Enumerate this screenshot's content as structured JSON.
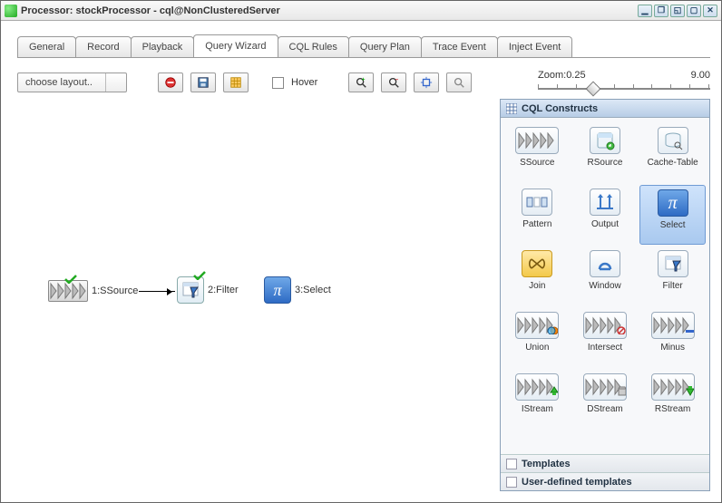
{
  "title": "Processor: stockProcessor - cql@NonClusteredServer",
  "tabs": [
    "General",
    "Record",
    "Playback",
    "Query Wizard",
    "CQL Rules",
    "Query Plan",
    "Trace Event",
    "Inject Event"
  ],
  "active_tab_index": 3,
  "layout_combo": "choose layout..",
  "hover_label": "Hover",
  "zoom": {
    "label": "Zoom:",
    "min": "0.25",
    "max": "9.00"
  },
  "nodes": {
    "n1": "1:SSource",
    "n2": "2:Filter",
    "n3": "3:Select"
  },
  "palette": {
    "header": "CQL Constructs",
    "items": [
      "SSource",
      "RSource",
      "Cache-Table",
      "Pattern",
      "Output",
      "Select",
      "Join",
      "Window",
      "Filter",
      "Union",
      "Intersect",
      "Minus",
      "IStream",
      "DStream",
      "RStream"
    ],
    "selected_index": 5,
    "templates": "Templates",
    "user_templates": "User-defined templates"
  }
}
